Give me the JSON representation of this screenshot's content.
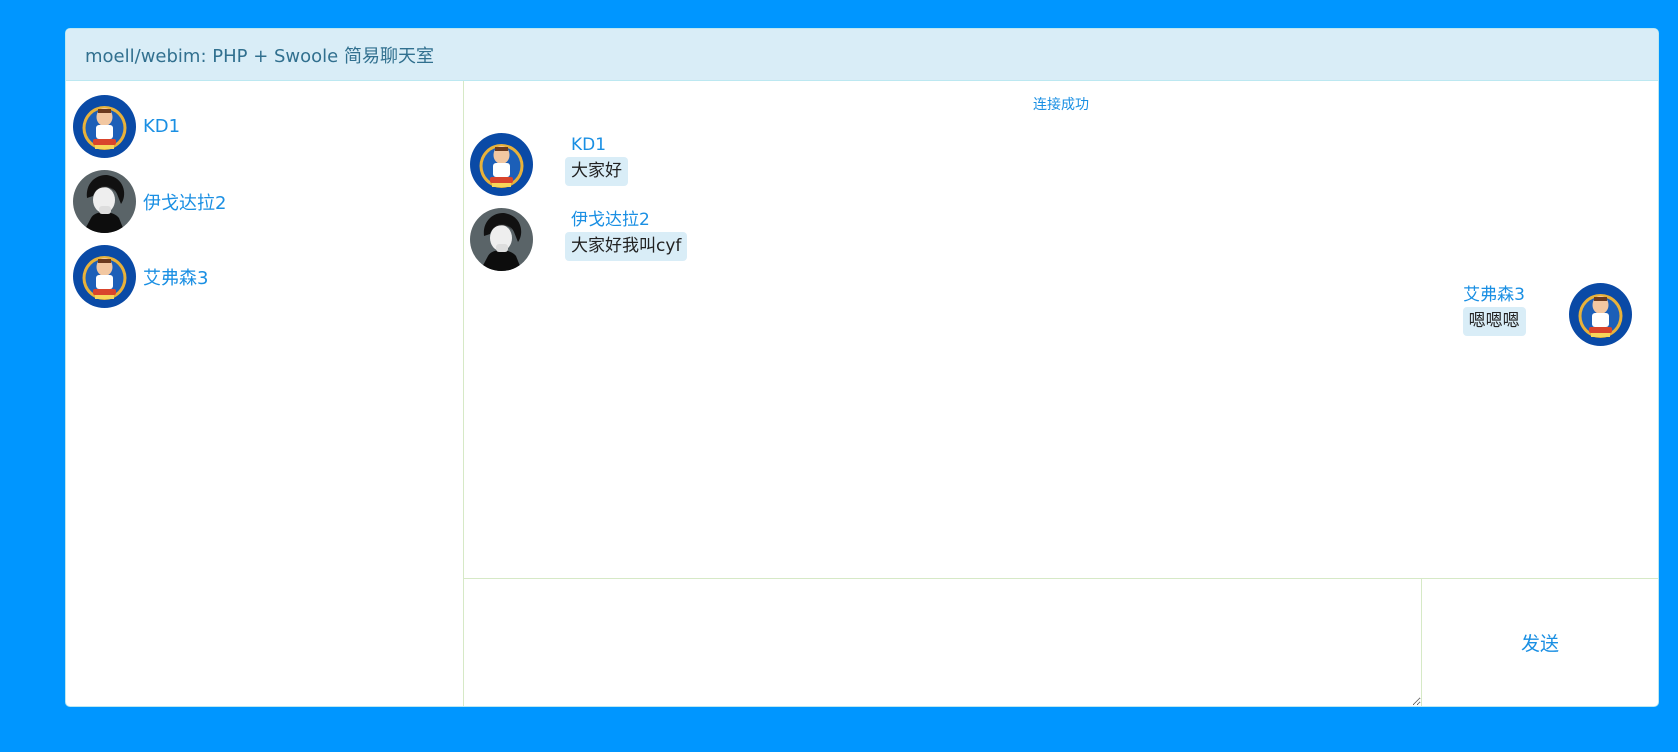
{
  "header": {
    "title": "moell/webim: PHP + Swoole 简易聊天室"
  },
  "users": [
    {
      "name": "KD1",
      "avatar": "cartoon-avatar-icon"
    },
    {
      "name": "伊戈达拉2",
      "avatar": "sketch-portrait-avatar-icon"
    },
    {
      "name": "艾弗森3",
      "avatar": "cartoon-avatar-icon"
    }
  ],
  "chat": {
    "system_notice": "连接成功",
    "messages": [
      {
        "author": "KD1",
        "text": "大家好",
        "side": "left",
        "avatar": "cartoon-avatar-icon"
      },
      {
        "author": "伊戈达拉2",
        "text": "大家好我叫cyf",
        "side": "left",
        "avatar": "sketch-portrait-avatar-icon"
      },
      {
        "author": "艾弗森3",
        "text": "嗯嗯嗯",
        "side": "right",
        "avatar": "cartoon-avatar-icon"
      }
    ]
  },
  "composer": {
    "input_value": "",
    "send_label": "发送"
  },
  "colors": {
    "page_background": "#0096ff",
    "header_background": "#d9edf7",
    "header_text": "#31708f",
    "link_blue": "#1a8fe3",
    "bubble_background": "#d9edf7",
    "cartoon_avatar_bg": "#0a4aa6",
    "sketch_avatar_bg": "#5a6468"
  }
}
